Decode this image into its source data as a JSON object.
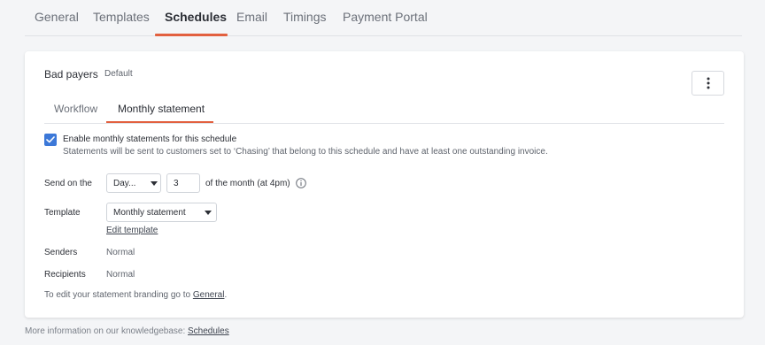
{
  "tabs": {
    "items": [
      {
        "label": "General"
      },
      {
        "label": "Templates"
      },
      {
        "label": "Schedules"
      },
      {
        "label": "Email"
      },
      {
        "label": "Timings"
      },
      {
        "label": "Payment Portal"
      }
    ],
    "active": "Schedules"
  },
  "schedule": {
    "name": "Bad payers",
    "badge": "Default",
    "menu_icon": "kebab-menu-icon"
  },
  "sub_tabs": {
    "items": [
      {
        "label": "Workflow"
      },
      {
        "label": "Monthly statement"
      }
    ],
    "active": "Monthly statement"
  },
  "enable": {
    "checked": true,
    "label": "Enable monthly statements for this schedule",
    "description": "Statements will be sent to customers set to ‘Chasing’ that belong to this schedule and have at least one outstanding invoice."
  },
  "send_on": {
    "label": "Send on the",
    "day_select": "Day...",
    "day_number": "3",
    "suffix": "of the month (at 4pm)",
    "info_icon": "info-icon"
  },
  "template": {
    "label": "Template",
    "selected": "Monthly statement",
    "edit_link": "Edit template"
  },
  "senders": {
    "label": "Senders",
    "value": "Normal"
  },
  "recipients": {
    "label": "Recipients",
    "value": "Normal"
  },
  "branding": {
    "text": "To edit your statement branding go to ",
    "link": "General",
    "end": "."
  },
  "footer": {
    "text": "More information on our knowledgebase: ",
    "link": "Schedules"
  },
  "colors": {
    "accent": "#e2603f",
    "checkbox": "#3c78d8",
    "background": "#f4f5f7"
  }
}
